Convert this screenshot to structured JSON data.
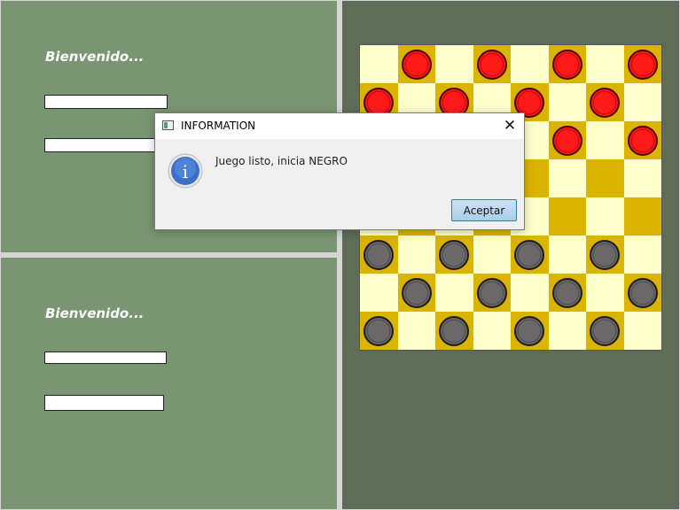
{
  "top_panel": {
    "welcome": "Bienvenido..."
  },
  "bottom_panel": {
    "welcome": "Bienvenido..."
  },
  "board": {
    "colors": {
      "light": "#ffffcc",
      "dark": "#dbb400"
    },
    "rows": [
      "_r_r_r_r",
      "r_r_r_r_",
      "_r_r_r_r",
      "________",
      "________",
      "b_b_b_b_",
      "_b_b_b_b",
      "b_b_b_b_"
    ]
  },
  "dialog": {
    "title": "INFORMATION",
    "message": "Juego listo, inicia NEGRO",
    "icon": "info-icon",
    "accept_label": "Aceptar",
    "close_glyph": "✕"
  }
}
